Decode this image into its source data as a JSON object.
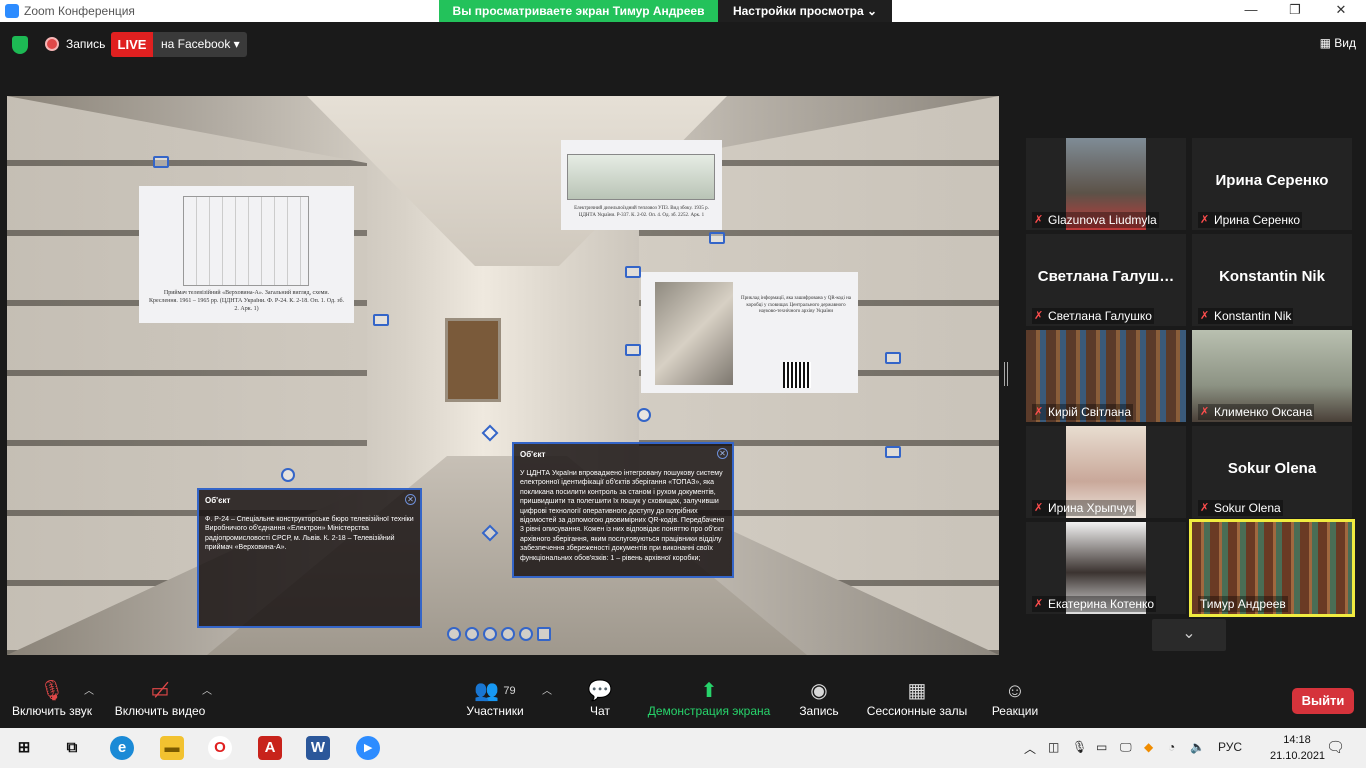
{
  "window": {
    "title": "Zoom Конференция",
    "min": "—",
    "max": "❐",
    "close": "✕"
  },
  "share_banner": {
    "text": "Вы просматриваете экран Тимур Андреев",
    "options": "Настройки просмотра ⌄"
  },
  "topbar": {
    "record_label": "Запись",
    "live_label": "LIVE",
    "live_target": "на Facebook ▾",
    "view_label": "Вид"
  },
  "shared_screen": {
    "panel1_caption": "Приймач телевізійний «Верховина-А». Загальний вигляд, схеми. Креслення. 1961 – 1965 рр. (ЦДНТА України. Ф. Р-24. К. 2-18. Оп. 1. Од. зб. 2. Арк. 1)",
    "panel2_caption": "Електричний дизельпоїздний тепловоз УП3. Вид збоку. 1935 р. ЦДНТА України. Р-337. К. 2-02. Оп. 4. Од. зб. 2252. Арк. 1",
    "panel3_caption": "Приклад інформації, яка зашифрована у QR-коді на коробці у сховищах Центрального державного науково-технічного архіву України",
    "info1": {
      "header": "Об'єкт",
      "text": "Ф. Р-24 – Спеціальне конструкторське бюро телевізійної техніки Виробничого об'єднання «Електрон» Міністерства радіопромисловості СРСР, м. Львів. К. 2-18 – Телевізійний приймач «Верховина-А»."
    },
    "info2": {
      "header": "Об'єкт",
      "text": "У ЦДНТА України впроваджено інтегровану пошукову систему електронної ідентифікації об'єктів зберігання «ТОПАЗ», яка покликана посилити контроль за станом і рухом документів, пришвидшити та полегшити їх пошук у сховищах, залучивши цифрові технології оперативного доступу до потрібних відомостей за допомогою двовимірних QR-кодів. Передбачено 3 рівні описування. Кожен із них відповідає поняттю про об'єкт архівного зберігання, яким послуговуються працівники відділу забезпечення збереженості документів при виконанні своїх функціональних обов'язків: 1 – рівень архівної коробки;"
    }
  },
  "participants": [
    {
      "name": "Glazunova Liudmyla",
      "video": true,
      "muted": true
    },
    {
      "name": "Ирина Серенко",
      "video": false,
      "muted": true,
      "display": "Ирина Серенко"
    },
    {
      "name": "Светлана Галушко",
      "video": false,
      "muted": true,
      "display": "Светлана  Галуш…"
    },
    {
      "name": "Konstantin Nik",
      "video": false,
      "muted": true,
      "display": "Konstantin Nik"
    },
    {
      "name": "Кирій Світлана",
      "video": true,
      "muted": true
    },
    {
      "name": "Клименко Оксана",
      "video": true,
      "muted": true
    },
    {
      "name": "Ирина Хрыпчук",
      "video": true,
      "muted": true
    },
    {
      "name": "Sokur Olena",
      "video": false,
      "muted": true,
      "display": "Sokur Olena"
    },
    {
      "name": "Екатерина Котенко",
      "video": true,
      "muted": true
    },
    {
      "name": "Тимур Андреев",
      "video": true,
      "muted": false,
      "active": true
    }
  ],
  "toolbar": {
    "audio": "Включить звук",
    "video": "Включить видео",
    "participants": "Участники",
    "participants_count": "79",
    "chat": "Чат",
    "share": "Демонстрация экрана",
    "record": "Запись",
    "breakout": "Сессионные залы",
    "reactions": "Реакции",
    "leave": "Выйти"
  },
  "taskbar": {
    "lang": "РУС",
    "time": "14:18",
    "date": "21.10.2021"
  }
}
